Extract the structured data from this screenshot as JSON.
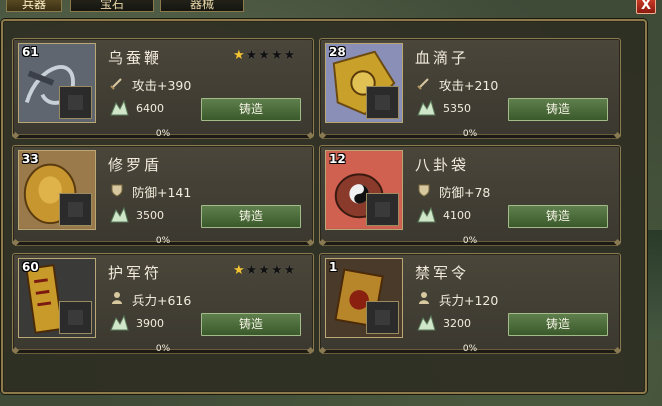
{
  "tabs": [
    {
      "label": "兵器"
    },
    {
      "label": "宝石"
    },
    {
      "label": "器械"
    }
  ],
  "close_label": "X",
  "colors": {
    "accent_gold": "#f4c531",
    "button_green": "#4b6b3c",
    "border_gold": "#8c7a4a"
  },
  "items": [
    {
      "level": "61",
      "name": "乌蚕鞭",
      "stars": "★★★★★",
      "stars_filled": 1,
      "stat_icon": "sword-icon",
      "stat": "攻击+390",
      "cost": "6400",
      "button": "铸造",
      "progress": "0%"
    },
    {
      "level": "28",
      "name": "血滴子",
      "stars": "",
      "stars_filled": 0,
      "stat_icon": "sword-icon",
      "stat": "攻击+210",
      "cost": "5350",
      "button": "铸造",
      "progress": "0%"
    },
    {
      "level": "33",
      "name": "修罗盾",
      "stars": "",
      "stars_filled": 0,
      "stat_icon": "shield-icon",
      "stat": "防御+141",
      "cost": "3500",
      "button": "铸造",
      "progress": "0%"
    },
    {
      "level": "12",
      "name": "八卦袋",
      "stars": "",
      "stars_filled": 0,
      "stat_icon": "shield-icon",
      "stat": "防御+78",
      "cost": "4100",
      "button": "铸造",
      "progress": "0%"
    },
    {
      "level": "60",
      "name": "护军符",
      "stars": "★★★★★",
      "stars_filled": 1,
      "stat_icon": "soldier-icon",
      "stat": "兵力+616",
      "cost": "3900",
      "button": "铸造",
      "progress": "0%"
    },
    {
      "level": "1",
      "name": "禁军令",
      "stars": "",
      "stars_filled": 0,
      "stat_icon": "soldier-icon",
      "stat": "兵力+120",
      "cost": "3200",
      "button": "铸造",
      "progress": "0%"
    }
  ]
}
